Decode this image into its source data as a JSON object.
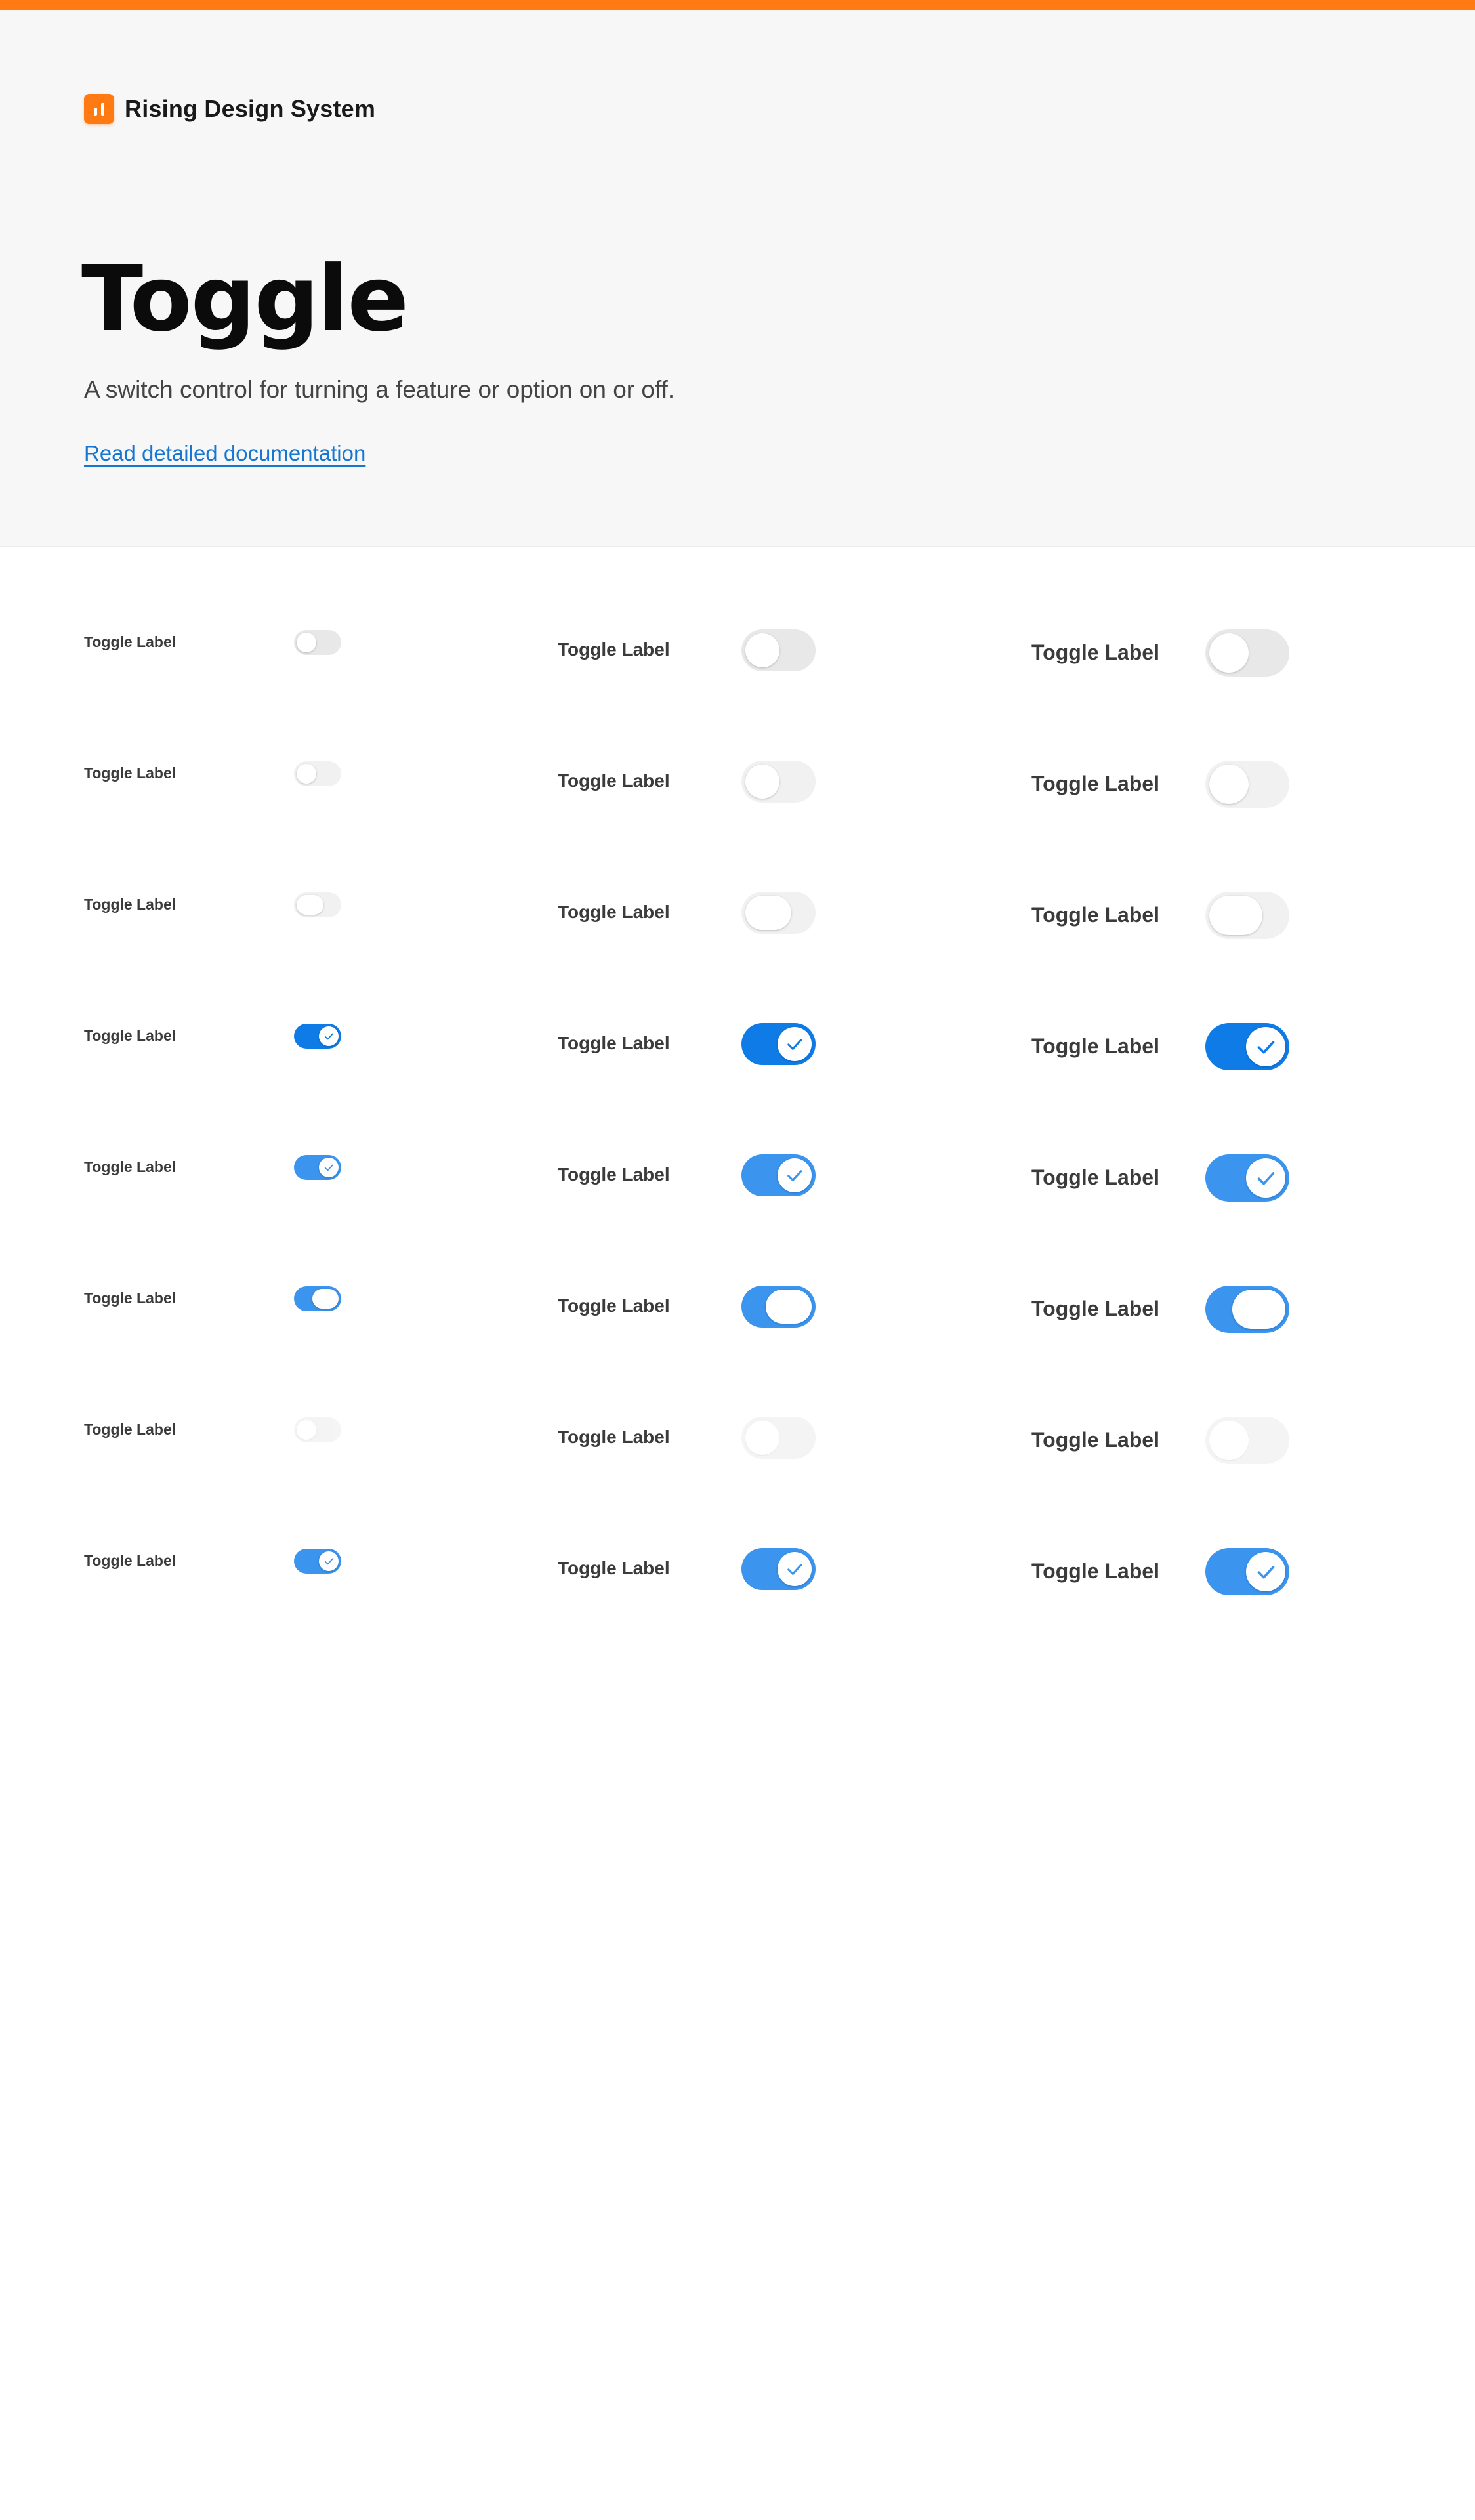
{
  "brand": {
    "name": "Rising Design System"
  },
  "hero": {
    "title": "Toggle",
    "subtitle": "A switch control for turning a feature or option on or off.",
    "doc_link": "Read detailed documentation"
  },
  "colors": {
    "accent": "#ff7a12",
    "link": "#1677d2",
    "toggle_on": "#0f7be6",
    "toggle_on_hover": "#3b94ee",
    "toggle_off": "#e8e8e8",
    "toggle_off_light": "#f1f1f1"
  },
  "columns": [
    {
      "size": "small"
    },
    {
      "size": "medium"
    },
    {
      "size": "large"
    }
  ],
  "rows": [
    {
      "label": "Toggle Label",
      "on": false,
      "tone": "off",
      "check": false,
      "knob": "round"
    },
    {
      "label": "Toggle Label",
      "on": false,
      "tone": "off-light",
      "check": false,
      "knob": "round"
    },
    {
      "label": "Toggle Label",
      "on": false,
      "tone": "off-light",
      "check": false,
      "knob": "wide"
    },
    {
      "label": "Toggle Label",
      "on": true,
      "tone": "on",
      "check": true,
      "knob": "round"
    },
    {
      "label": "Toggle Label",
      "on": true,
      "tone": "on-hover",
      "check": true,
      "knob": "round"
    },
    {
      "label": "Toggle Label",
      "on": true,
      "tone": "on-hover",
      "check": false,
      "knob": "wide"
    },
    {
      "label": "Toggle Label",
      "on": false,
      "tone": "disabled",
      "check": false,
      "knob": "round"
    },
    {
      "label": "Toggle Label",
      "on": true,
      "tone": "on-hover",
      "check": true,
      "knob": "round"
    }
  ]
}
